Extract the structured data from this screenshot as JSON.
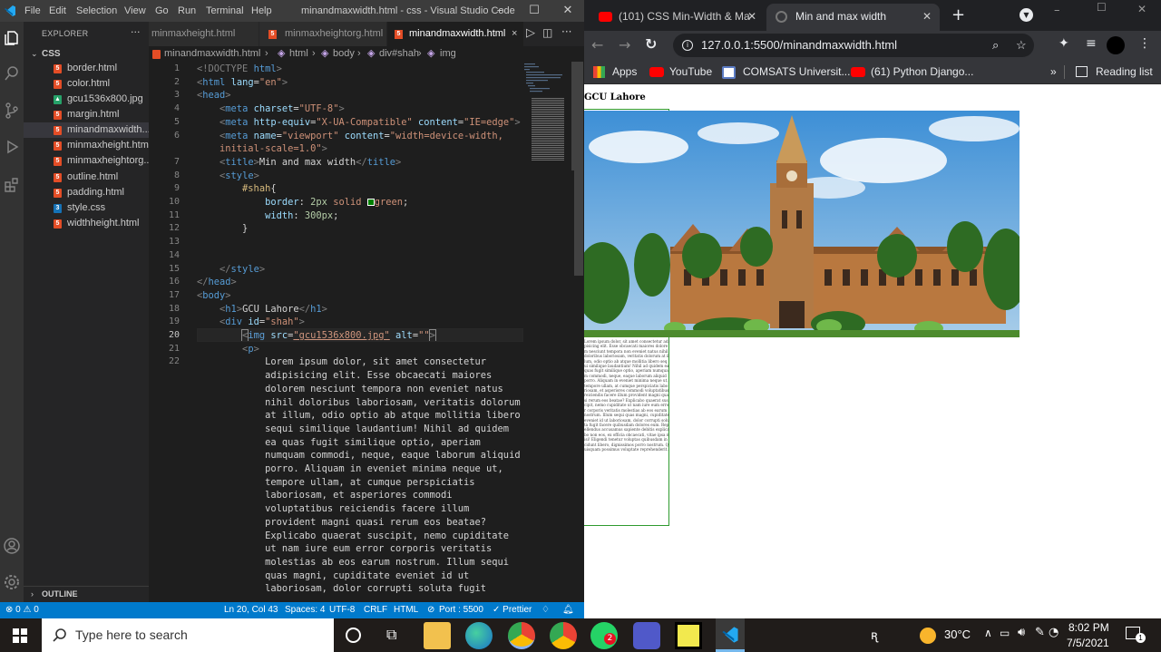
{
  "vscode": {
    "menu": [
      "File",
      "Edit",
      "Selection",
      "View",
      "Go",
      "Run",
      "Terminal",
      "Help"
    ],
    "title": "minandmaxwidth.html - css - Visual Studio Code",
    "explorer_title": "EXPLORER",
    "folder": "CSS",
    "files": [
      "border.html",
      "color.html",
      "gcu1536x800.jpg",
      "margin.html",
      "minandmaxwidth....",
      "minmaxheight.html",
      "minmaxheightorg....",
      "outline.html",
      "padding.html",
      "style.css",
      "widthheight.html"
    ],
    "outline": "OUTLINE",
    "tabs": [
      "minmaxheight.html",
      "minmaxheightorg.html",
      "minandmaxwidth.html"
    ],
    "breadcrumb": [
      "minandmaxwidth.html",
      "html",
      "body",
      "div#shah",
      "img"
    ],
    "code_lines": [
      {
        "n": "1",
        "html": "<span class='g'>&lt;!DOCTYPE</span> <span class='t'>html</span><span class='g'>&gt;</span>"
      },
      {
        "n": "2",
        "html": "<span class='g'>&lt;</span><span class='t'>html</span> <span class='a'>lang</span>=<span class='s'>\"en\"</span><span class='g'>&gt;</span>"
      },
      {
        "n": "3",
        "html": "<span class='g'>&lt;</span><span class='t'>head</span><span class='g'>&gt;</span>"
      },
      {
        "n": "4",
        "html": "    <span class='g'>&lt;</span><span class='t'>meta</span> <span class='a'>charset</span>=<span class='s'>\"UTF-8\"</span><span class='g'>&gt;</span>"
      },
      {
        "n": "5",
        "html": "    <span class='g'>&lt;</span><span class='t'>meta</span> <span class='a'>http-equiv</span>=<span class='s'>\"X-UA-Compatible\"</span> <span class='a'>content</span>=<span class='s'>\"IE=edge\"</span><span class='g'>&gt;</span>"
      },
      {
        "n": "6",
        "html": "    <span class='g'>&lt;</span><span class='t'>meta</span> <span class='a'>name</span>=<span class='s'>\"viewport\"</span> <span class='a'>content</span>=<span class='s'>\"width=device-width,</span>"
      },
      {
        "n": "",
        "html": "    <span class='s'>initial-scale=1.0\"</span><span class='g'>&gt;</span>"
      },
      {
        "n": "7",
        "html": "    <span class='g'>&lt;</span><span class='t'>title</span><span class='g'>&gt;</span>Min and max width<span class='g'>&lt;/</span><span class='t'>title</span><span class='g'>&gt;</span>"
      },
      {
        "n": "8",
        "html": "    <span class='g'>&lt;</span><span class='t'>style</span><span class='g'>&gt;</span>"
      },
      {
        "n": "9",
        "html": "        <span class='sel'>#shah</span>{"
      },
      {
        "n": "10",
        "html": "            <span class='a'>border</span>: <span class='n'>2px</span> <span class='s'>solid</span> <span style='display:inline-block;width:8px;height:8px;border:1px solid #fff;background:green;vertical-align:middle'></span><span class='s'>green</span>;"
      },
      {
        "n": "11",
        "html": "            <span class='a'>width</span>: <span class='n'>300px</span>;"
      },
      {
        "n": "12",
        "html": "        }"
      },
      {
        "n": "13",
        "html": ""
      },
      {
        "n": "14",
        "html": ""
      },
      {
        "n": "15",
        "html": "    <span class='g'>&lt;/</span><span class='t'>style</span><span class='g'>&gt;</span>"
      },
      {
        "n": "16",
        "html": "<span class='g'>&lt;/</span><span class='t'>head</span><span class='g'>&gt;</span>"
      },
      {
        "n": "17",
        "html": "<span class='g'>&lt;</span><span class='t'>body</span><span class='g'>&gt;</span>"
      },
      {
        "n": "18",
        "html": "    <span class='g'>&lt;</span><span class='t'>h1</span><span class='g'>&gt;</span>GCU Lahore<span class='g'>&lt;/</span><span class='t'>h1</span><span class='g'>&gt;</span>"
      },
      {
        "n": "19",
        "html": "    <span class='g'>&lt;</span><span class='t'>div</span> <span class='a'>id</span>=<span class='s'>\"shah\"</span><span class='g'>&gt;</span>"
      },
      {
        "n": "20",
        "html": "        <span class='g' style='outline:1px solid #888'>&lt;</span><span class='t'>img</span> <span class='a'>src</span>=<span class='s' style='text-decoration:underline'>\"gcu1536x800.jpg\"</span> <span class='a'>alt</span>=<span class='s'>\"\"</span><span class='g' style='outline:1px solid #888'>&gt;</span>"
      },
      {
        "n": "21",
        "html": "        <span class='g'>&lt;</span><span class='t'>p</span><span class='g'>&gt;</span>"
      },
      {
        "n": "22",
        "html": "            Lorem ipsum dolor, sit amet consectetur"
      },
      {
        "n": "",
        "html": "            adipisicing elit. Esse obcaecati maiores"
      },
      {
        "n": "",
        "html": "            dolorem nesciunt tempora non eveniet natus"
      },
      {
        "n": "",
        "html": "            nihil doloribus laboriosam, veritatis dolorum"
      },
      {
        "n": "",
        "html": "            at illum, odio optio ab atque mollitia libero"
      },
      {
        "n": "",
        "html": "            sequi similique laudantium! Nihil ad quidem"
      },
      {
        "n": "",
        "html": "            ea quas fugit similique optio, aperiam"
      },
      {
        "n": "",
        "html": "            numquam commodi, neque, eaque laborum aliquid"
      },
      {
        "n": "",
        "html": "            porro. Aliquam in eveniet minima neque ut,"
      },
      {
        "n": "",
        "html": "            tempore ullam, at cumque perspiciatis"
      },
      {
        "n": "",
        "html": "            laboriosam, et asperiores commodi"
      },
      {
        "n": "",
        "html": "            voluptatibus reiciendis facere illum"
      },
      {
        "n": "",
        "html": "            provident magni quasi rerum eos beatae?"
      },
      {
        "n": "",
        "html": "            Explicabo quaerat suscipit, nemo cupiditate"
      },
      {
        "n": "",
        "html": "            ut nam iure eum error corporis veritatis"
      },
      {
        "n": "",
        "html": "            molestias ab eos earum nostrum. Illum sequi"
      },
      {
        "n": "",
        "html": "            quas magni, cupiditate eveniet id ut"
      },
      {
        "n": "",
        "html": "            laboriosam, dolor corrupti soluta fugit"
      }
    ],
    "status": {
      "problems": "⊗ 0 ⚠ 0",
      "position": "Ln 20, Col 43",
      "spaces": "Spaces: 4",
      "encoding": "UTF-8",
      "eol": "CRLF",
      "lang": "HTML",
      "port": "Port : 5500",
      "prettier": "✓ Prettier"
    }
  },
  "chrome": {
    "tabs": [
      "(101) CSS Min-Width & Ma",
      "Min and max width"
    ],
    "url": "127.0.0.1:5500/minandmaxwidth.html",
    "bookmarks": [
      "Apps",
      "YouTube",
      "COMSATS Universit...",
      "(61) Python Django...",
      "Reading list"
    ],
    "page_heading": "GCU Lahore",
    "paragraph": "Lorem ipsum dolor, sit amet consectetur adipisicing elit. Esse obcaecati maiores dolorem nesciunt tempora non eveniet natus nihil doloribus laboriosam, veritatis dolorum at illum, odio optio ab atque mollitia libero sequi similique laudantium! Nihil ad quidem ea quas fugit similique optio, aperiam numquam commodi, neque, eaque laborum aliquid porro. Aliquam in eveniet minima neque ut, tempore ullam, at cumque perspiciatis laboriosam, et asperiores commodi voluptatibus reiciendis facere illum provident magni quasi rerum eos beatae? Explicabo quaerat suscipit, nemo cupiditate ut nam iure eum error corporis veritatis molestias ab eos earum nostrum. Illum sequi quas magni, cupiditate eveniet id ut laboriosam, dolor corrupti soluta fugit facere quibusdam dolores eum. Repellendus accusamus sapiente debitis explicabo non eos, ex officia obcaecati, vitae ipsa nisi! Eligendi tenetur voluptas quibusdam incidunt libero, dignissimos porro nostrum. Quisquam possimus voluptate reprehenderit."
  },
  "taskbar": {
    "search_placeholder": "Type here to search",
    "temperature": "30°C",
    "time": "8:02 PM",
    "date": "7/5/2021",
    "notifications": "1"
  }
}
